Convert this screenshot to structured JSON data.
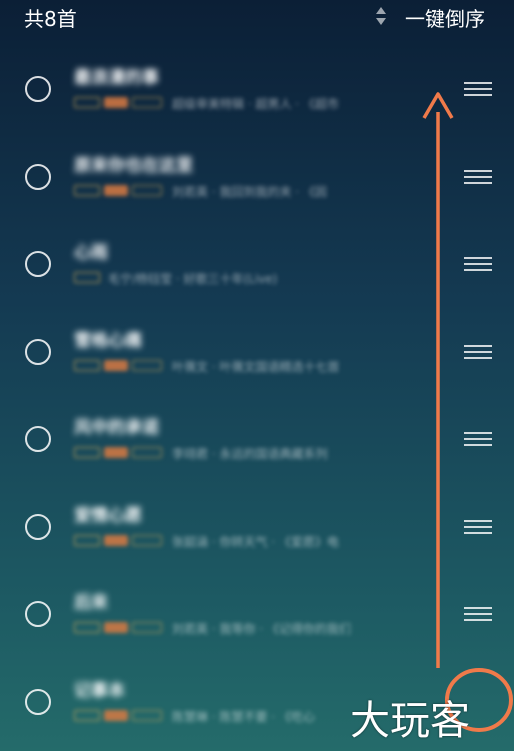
{
  "header": {
    "count_label": "共8首",
    "reverse_label": "一键倒序"
  },
  "songs": [
    {
      "title": "最浪漫的事",
      "subtitle": "超级审美特辑 · 超男人 · 《超市"
    },
    {
      "title": "原来你也在这里",
      "subtitle": "刘若英 · 我回到我的夹 · 《因"
    },
    {
      "title": "心雨",
      "subtitle": "毛宁/杨钰莹 · 好歌三十年(Live)"
    },
    {
      "title": "雪格心痛",
      "subtitle": "叶蒨文 · 叶蒨文国语精选十七首"
    },
    {
      "title": "风中的承诺",
      "subtitle": "李翊君 · 永远的国语典藏系列"
    },
    {
      "title": "爱情心愿",
      "subtitle": "张韶涵 · 你转天气 · 《爱愿》电"
    },
    {
      "title": "后来",
      "subtitle": "刘若英 · 我等你 · 《记得你的我们"
    },
    {
      "title": "记事本",
      "subtitle": "陈慧琳 · 陈慧不要 · 《吃心"
    }
  ],
  "watermark": "大玩客",
  "colors": {
    "arrow": "#f07a4a",
    "tag_gold": "#d6ac58",
    "tag_orange": "#d87a42"
  }
}
